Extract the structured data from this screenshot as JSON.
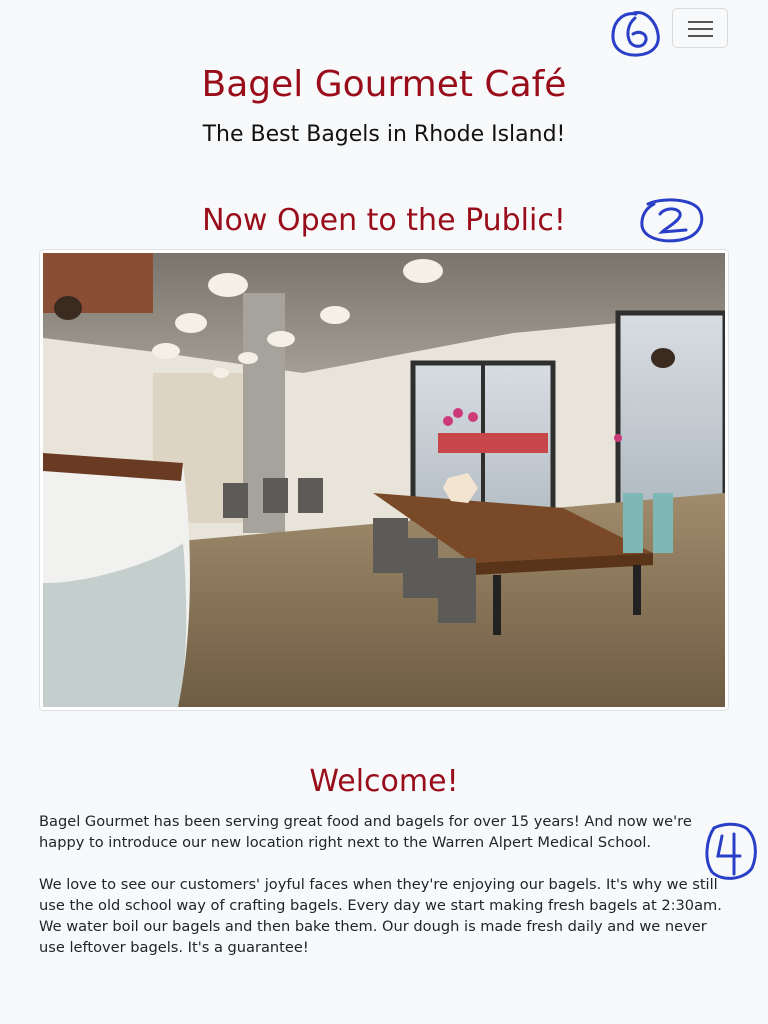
{
  "navbar": {
    "toggler_icon": "hamburger-menu-icon"
  },
  "header": {
    "title": "Bagel Gourmet Café",
    "tagline": "The Best Bagels in Rhode Island!"
  },
  "hero": {
    "heading": "Now Open to the Public!",
    "image": "cafe-interior-photo"
  },
  "welcome": {
    "heading": "Welcome!",
    "paragraphs": [
      "Bagel Gourmet has been serving great food and bagels for over 15 years! And now we're happy to introduce our new location right next to the Warren Alpert Medical School.",
      "We love to see our customers' joyful faces when they're enjoying our bagels. It's why we still use the old school way of crafting bagels. Every day we start making fresh bagels at 2:30am. We water boil our bagels and then bake them. Our dough is made fresh daily and we never use leftover bagels. It's a guarantee!"
    ]
  },
  "colors": {
    "brand": "#990d1b",
    "background": "#f8f9fa",
    "annotation_ink": "#2a3fc7"
  }
}
